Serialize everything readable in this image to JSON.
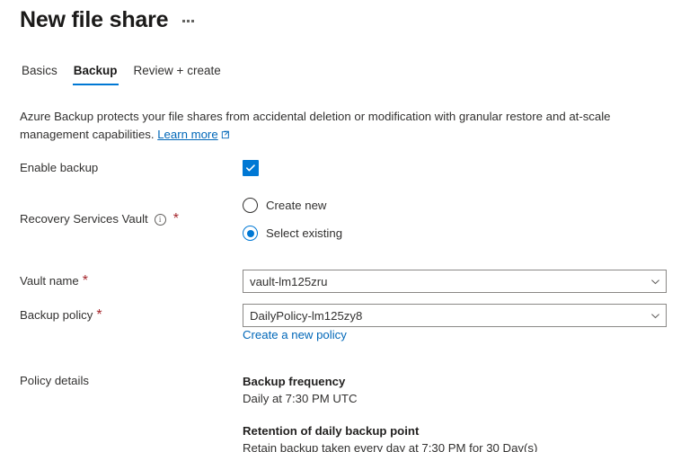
{
  "header": {
    "title": "New file share",
    "more_actions": "…"
  },
  "tabs": [
    {
      "label": "Basics",
      "active": false
    },
    {
      "label": "Backup",
      "active": true
    },
    {
      "label": "Review + create",
      "active": false
    }
  ],
  "description": {
    "text": "Azure Backup protects your file shares from accidental deletion or modification with granular restore and at-scale management capabilities.",
    "link_label": "Learn more"
  },
  "form": {
    "enable_backup": {
      "label": "Enable backup",
      "checked": true
    },
    "recovery_services_vault": {
      "label": "Recovery Services Vault",
      "required_marker": "*",
      "options": [
        {
          "label": "Create new",
          "selected": false
        },
        {
          "label": "Select existing",
          "selected": true
        }
      ]
    },
    "vault_name": {
      "label": "Vault name",
      "required_marker": "*",
      "value": "vault-lm125zru"
    },
    "backup_policy": {
      "label": "Backup policy",
      "required_marker": "*",
      "value": "DailyPolicy-lm125zy8",
      "create_link": "Create a new policy"
    },
    "policy_details": {
      "label": "Policy details",
      "blocks": [
        {
          "heading": "Backup frequency",
          "text": "Daily at 7:30 PM UTC"
        },
        {
          "heading": "Retention of daily backup point",
          "text": "Retain backup taken every day at 7:30 PM for 30 Day(s)"
        }
      ]
    }
  },
  "colors": {
    "accent": "#0078d4",
    "link": "#0067b8",
    "required": "#a4262c",
    "text": "#323130"
  }
}
